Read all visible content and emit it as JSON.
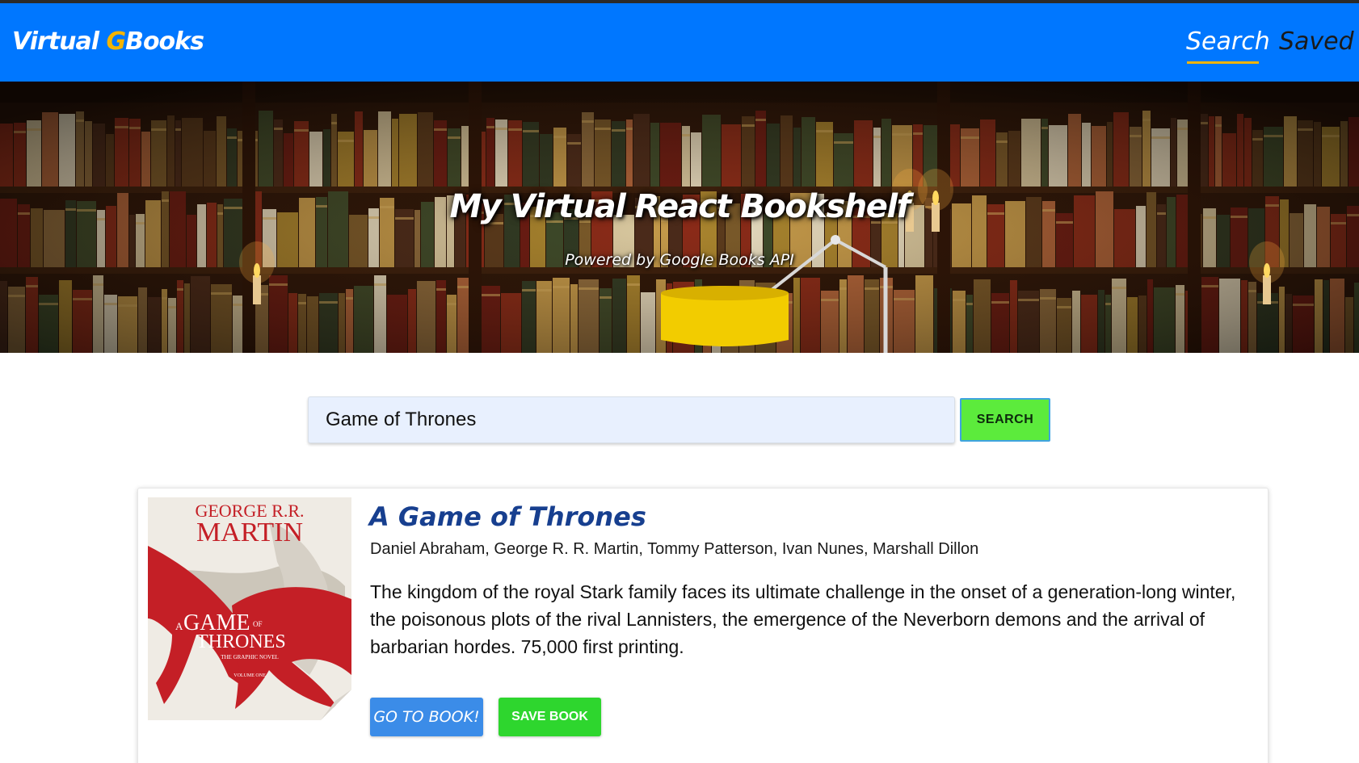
{
  "navbar": {
    "brand_prefix": "Virtual ",
    "brand_g": "G",
    "brand_suffix": "Books",
    "links": [
      {
        "label": "Search",
        "active": true
      },
      {
        "label": "Saved",
        "active": false
      }
    ]
  },
  "hero": {
    "title": "My Virtual React Bookshelf",
    "subtitle": "Powered by Google Books API"
  },
  "search": {
    "query": "Game of Thrones",
    "button_label": "SEARCH"
  },
  "results": [
    {
      "title": "A Game of Thrones",
      "authors": "Daniel Abraham, George R. R. Martin, Tommy Patterson, Ivan Nunes, Marshall Dillon",
      "description": "The kingdom of the royal Stark family faces its ultimate challenge in the onset of a generation-long winter, the poisonous plots of the rival Lannisters, the emergence of the Neverborn demons and the arrival of barbarian hordes. 75,000 first printing.",
      "goto_label": "GO TO BOOK!",
      "save_label": "SAVE BOOK",
      "cover": {
        "author_line1": "GEORGE R.R.",
        "author_line2": "MARTIN",
        "title_line1": "GAME",
        "title_prefix": "A",
        "title_of": "OF",
        "title_line2": "THRONES",
        "subtitle": "THE GRAPHIC NOVEL",
        "volume": "VOLUME ONE"
      }
    }
  ],
  "colors": {
    "navbar": "#0077ff",
    "brand_accent": "#f4b400",
    "search_button": "#5ceb3c",
    "goto_button": "#3b8ce8",
    "save_button": "#2ed62e",
    "book_title": "#173f8f"
  },
  "icons": {
    "hero_background": "bookshelf-image",
    "book_cover": "book-cover-image"
  }
}
